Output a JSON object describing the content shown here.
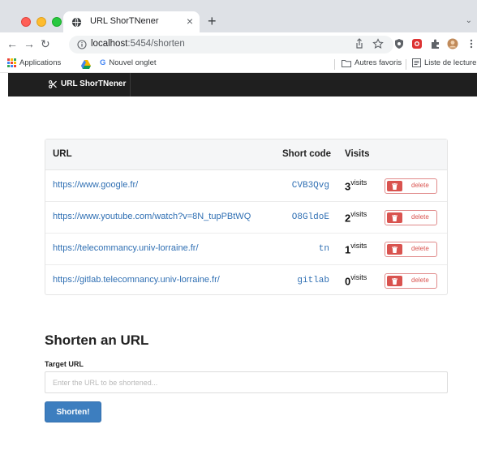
{
  "browser": {
    "tab_title": "URL ShorTNener",
    "tab_close": "×",
    "new_tab": "+",
    "tabs_menu": "⌄",
    "url_host": "localhost",
    "url_path": ":5454/shorten",
    "nav": {
      "back": "←",
      "forward": "→",
      "reload": "↻"
    },
    "bookmarks": {
      "apps": "Applications",
      "new_tab": "Nouvel onglet",
      "other": "Autres favoris",
      "reading": "Liste de lecture"
    }
  },
  "navbar": {
    "brand": "URL ShorTNener"
  },
  "table": {
    "headers": {
      "url": "URL",
      "code": "Short code",
      "visits": "Visits"
    },
    "rows": [
      {
        "url": "https://www.google.fr/",
        "code": "CVB3Qvg",
        "count": "3",
        "label": "visits",
        "action": "delete"
      },
      {
        "url": "https://www.youtube.com/watch?v=8N_tupPBtWQ",
        "code": "O8GldoE",
        "count": "2",
        "label": "visits",
        "action": "delete"
      },
      {
        "url": "https://telecommancy.univ-lorraine.fr/",
        "code": "tn",
        "count": "1",
        "label": "visits",
        "action": "delete"
      },
      {
        "url": "https://gitlab.telecomnancy.univ-lorraine.fr/",
        "code": "gitlab",
        "count": "0",
        "label": "visits",
        "action": "delete"
      }
    ]
  },
  "form": {
    "title": "Shorten an URL",
    "label": "Target URL",
    "placeholder": "Enter the URL to be shortened...",
    "value": "",
    "submit": "Shorten!"
  },
  "colors": {
    "link": "#2f6fb3",
    "danger": "#d9534f",
    "primary": "#3d7ebf",
    "navbar": "#1f1f1f"
  }
}
